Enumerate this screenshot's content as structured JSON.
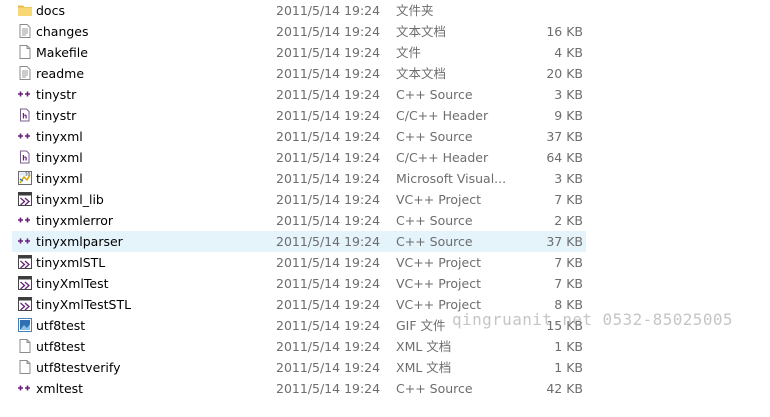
{
  "files": [
    {
      "name": "docs",
      "date": "2011/5/14 19:24",
      "type": "文件夹",
      "size": "",
      "icon": "folder-icon"
    },
    {
      "name": "changes",
      "date": "2011/5/14 19:24",
      "type": "文本文档",
      "size": "16 KB",
      "icon": "text-document-icon"
    },
    {
      "name": "Makefile",
      "date": "2011/5/14 19:24",
      "type": "文件",
      "size": "4 KB",
      "icon": "blank-file-icon"
    },
    {
      "name": "readme",
      "date": "2011/5/14 19:24",
      "type": "文本文档",
      "size": "20 KB",
      "icon": "text-document-icon"
    },
    {
      "name": "tinystr",
      "date": "2011/5/14 19:24",
      "type": "C++ Source",
      "size": "3 KB",
      "icon": "cpp-source-icon"
    },
    {
      "name": "tinystr",
      "date": "2011/5/14 19:24",
      "type": "C/C++ Header",
      "size": "9 KB",
      "icon": "cpp-header-icon"
    },
    {
      "name": "tinyxml",
      "date": "2011/5/14 19:24",
      "type": "C++ Source",
      "size": "37 KB",
      "icon": "cpp-source-icon"
    },
    {
      "name": "tinyxml",
      "date": "2011/5/14 19:24",
      "type": "C/C++ Header",
      "size": "64 KB",
      "icon": "cpp-header-icon"
    },
    {
      "name": "tinyxml",
      "date": "2011/5/14 19:24",
      "type": "Microsoft Visual...",
      "size": "3 KB",
      "icon": "visual-studio-solution-icon"
    },
    {
      "name": "tinyxml_lib",
      "date": "2011/5/14 19:24",
      "type": "VC++ Project",
      "size": "7 KB",
      "icon": "vc-project-icon"
    },
    {
      "name": "tinyxmlerror",
      "date": "2011/5/14 19:24",
      "type": "C++ Source",
      "size": "2 KB",
      "icon": "cpp-source-icon"
    },
    {
      "name": "tinyxmlparser",
      "date": "2011/5/14 19:24",
      "type": "C++ Source",
      "size": "37 KB",
      "icon": "cpp-source-icon",
      "hover": true
    },
    {
      "name": "tinyxmlSTL",
      "date": "2011/5/14 19:24",
      "type": "VC++ Project",
      "size": "7 KB",
      "icon": "vc-project-icon"
    },
    {
      "name": "tinyXmlTest",
      "date": "2011/5/14 19:24",
      "type": "VC++ Project",
      "size": "7 KB",
      "icon": "vc-project-icon"
    },
    {
      "name": "tinyXmlTestSTL",
      "date": "2011/5/14 19:24",
      "type": "VC++ Project",
      "size": "8 KB",
      "icon": "vc-project-icon"
    },
    {
      "name": "utf8test",
      "date": "2011/5/14 19:24",
      "type": "GIF 文件",
      "size": "15 KB",
      "icon": "gif-image-icon"
    },
    {
      "name": "utf8test",
      "date": "2011/5/14 19:24",
      "type": "XML 文档",
      "size": "1 KB",
      "icon": "blank-file-icon"
    },
    {
      "name": "utf8testverify",
      "date": "2011/5/14 19:24",
      "type": "XML 文档",
      "size": "1 KB",
      "icon": "blank-file-icon"
    },
    {
      "name": "xmltest",
      "date": "2011/5/14 19:24",
      "type": "C++ Source",
      "size": "42 KB",
      "icon": "cpp-source-icon"
    }
  ],
  "watermark": "qingruanit.net 0532-85025005",
  "colors": {
    "row_hover": "#e5f3fb",
    "folder": "#f8d775",
    "cpp_accent": "#68217a",
    "secondary_text": "#6d6d6d"
  }
}
